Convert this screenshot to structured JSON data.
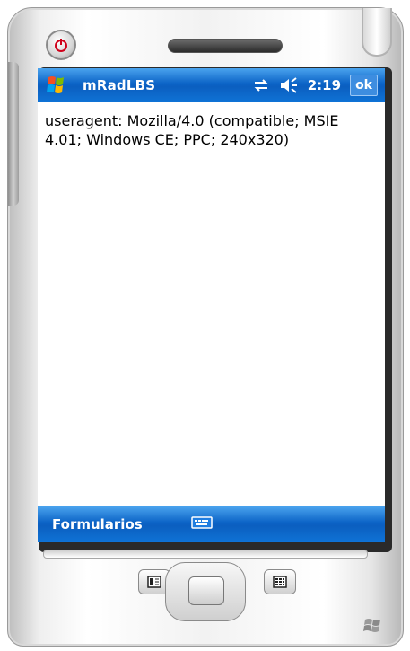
{
  "window": {
    "app_title": "mRadLBS",
    "clock": "2:19",
    "ok_label": "ok"
  },
  "content": {
    "text": "useragent: Mozilla/4.0 (compatible; MSIE 4.01; Windows CE; PPC; 240x320)"
  },
  "menu_bar": {
    "left_softkey": "Formularios"
  },
  "icons": {
    "start": "windows-flag-icon",
    "connectivity": "sync-arrows-icon",
    "volume": "speaker-volume-icon",
    "keyboard": "keyboard-icon",
    "power": "power-icon",
    "left_hardware_key": "calendar-icon",
    "right_hardware_key": "contacts-icon",
    "brand_logo": "windows-logo-icon"
  },
  "colors": {
    "title_bar": "#0b63c6",
    "menu_bar": "#0b63c6",
    "power_icon": "#d0021b"
  }
}
